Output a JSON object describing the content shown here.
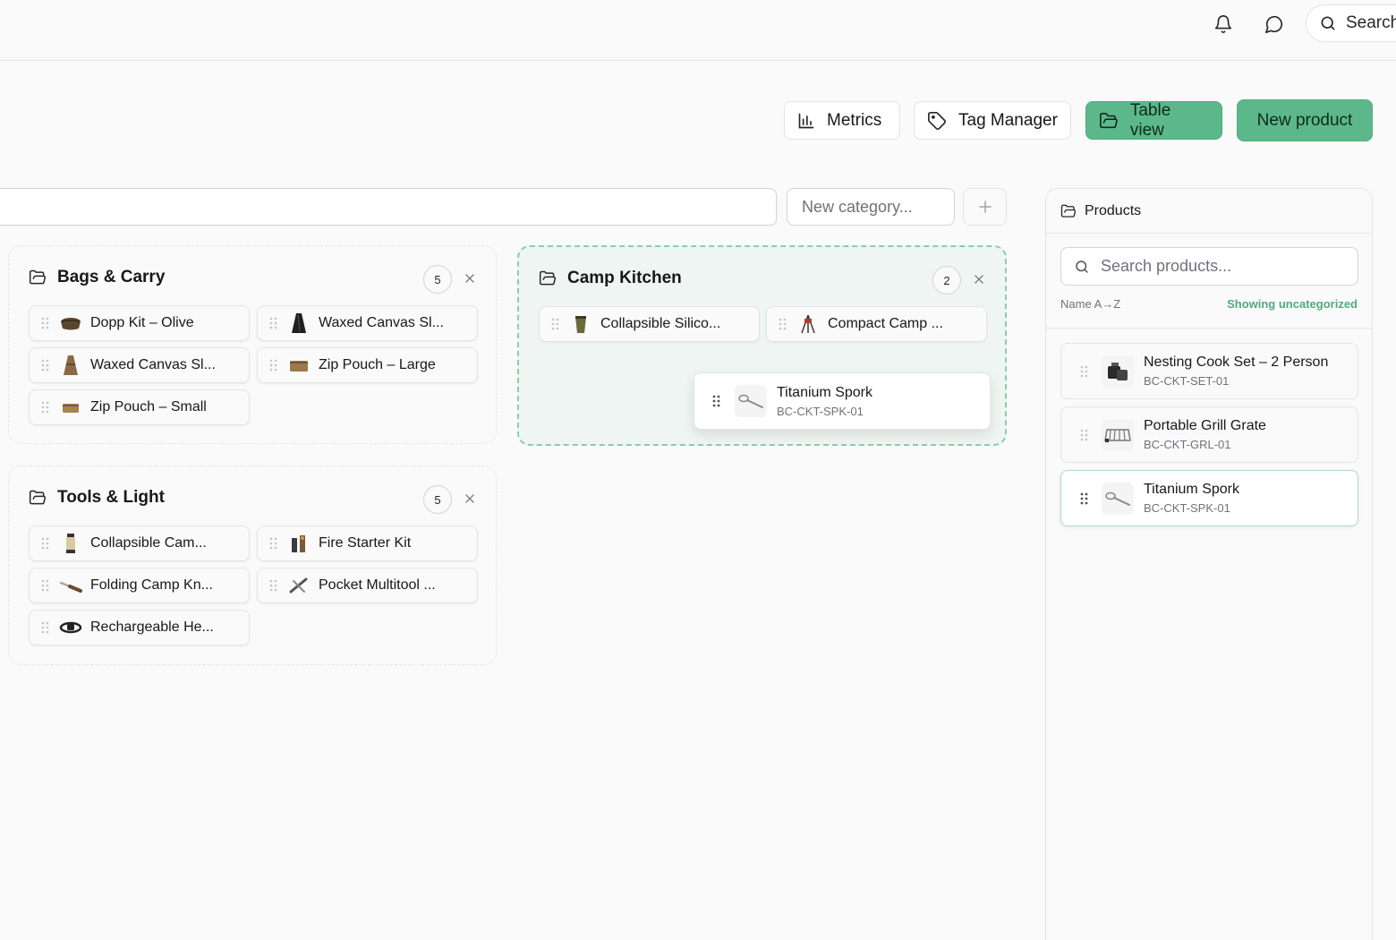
{
  "topbar": {
    "search_label": "Search"
  },
  "toolbar": {
    "metrics_label": "Metrics",
    "tag_manager_label": "Tag Manager",
    "table_view_label": "Table view",
    "new_product_label": "New product"
  },
  "category_bar": {
    "new_category_placeholder": "New category..."
  },
  "categories": [
    {
      "name": "Bags & Carry",
      "count": "5",
      "items": [
        "Dopp Kit – Olive",
        "Waxed Canvas Sl...",
        "Waxed Canvas Sl...",
        "Zip Pouch – Large",
        "Zip Pouch – Small"
      ]
    },
    {
      "name": "Camp Kitchen",
      "count": "2",
      "items": [
        "Collapsible Silico...",
        "Compact Camp ..."
      ]
    },
    {
      "name": "Tools & Light",
      "count": "5",
      "items": [
        "Collapsible Cam...",
        "Fire Starter Kit",
        "Folding Camp Kn...",
        "Pocket Multitool ...",
        "Rechargeable He..."
      ]
    }
  ],
  "drag_preview": {
    "title": "Titanium Spork",
    "sku": "BC-CKT-SPK-01"
  },
  "products_panel": {
    "title": "Products",
    "search_placeholder": "Search products...",
    "sort_label": "Name A→Z",
    "filter_label": "Showing uncategorized",
    "items": [
      {
        "title": "Nesting Cook Set – 2 Person",
        "sku": "BC-CKT-SET-01"
      },
      {
        "title": "Portable Grill Grate",
        "sku": "BC-CKT-GRL-01"
      },
      {
        "title": "Titanium Spork",
        "sku": "BC-CKT-SPK-01"
      }
    ]
  },
  "colors": {
    "accent_green": "#5cb88a",
    "active_drop_border": "#86cfae",
    "active_drop_bg": "#eff5f2"
  }
}
